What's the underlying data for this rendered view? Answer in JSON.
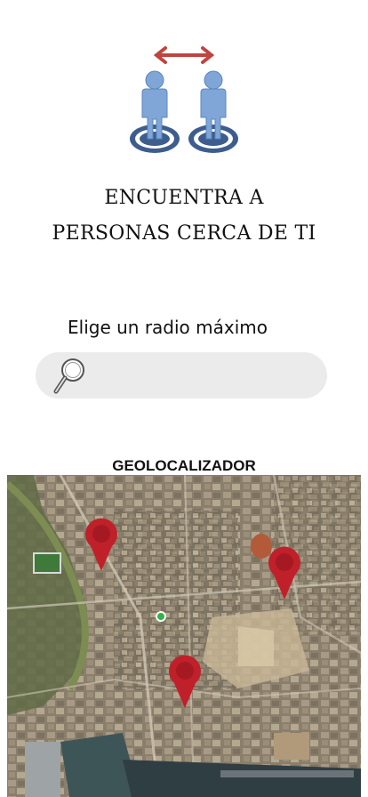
{
  "header": {
    "title_line1": "ENCUENTRA A",
    "title_line2": "PERSONAS CERCA DE TI"
  },
  "radius": {
    "label": "Elige un radio máximo",
    "placeholder": "",
    "value": ""
  },
  "map": {
    "title": "GEOLOCALIZADOR",
    "pins": [
      {
        "name": "pin-1",
        "color": "#c0202a"
      },
      {
        "name": "pin-2",
        "color": "#c0202a"
      },
      {
        "name": "pin-3",
        "color": "#c0202a"
      }
    ],
    "user_marker_color": "#2fb34a"
  },
  "colors": {
    "accent_arrow": "#c0443f",
    "person_blue": "#7fa6d6",
    "ring_navy": "#3d5d8f",
    "search_bg": "#ebebeb"
  },
  "icons": [
    "people-nearby-icon",
    "double-arrow-icon",
    "magnifier-icon",
    "map-pin-icon"
  ]
}
